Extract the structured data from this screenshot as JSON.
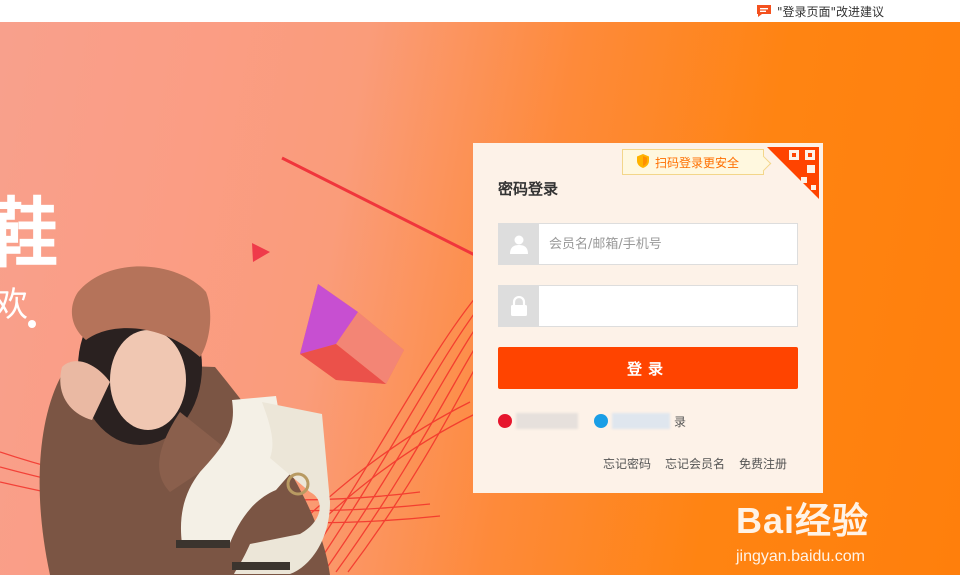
{
  "topbar": {
    "feedback_text": "\"登录页面\"改进建议",
    "feedback_icon": "chat-bubble-icon"
  },
  "banner": {
    "hero_text": "鞋",
    "hero_text2": "欢"
  },
  "login": {
    "title": "密码登录",
    "scan_tip": "扫码登录更安全",
    "username": {
      "placeholder": "会员名/邮箱/手机号",
      "value": "",
      "icon": "user-icon"
    },
    "password": {
      "placeholder": "",
      "value": "",
      "icon": "lock-icon"
    },
    "submit_label": "登录",
    "third_party": [
      {
        "icon": "weibo-icon",
        "label": ""
      },
      {
        "icon": "alipay-icon",
        "label": "录"
      }
    ],
    "links": [
      "忘记密码",
      "忘记会员名",
      "免费注册"
    ]
  },
  "watermark": {
    "brand": "Bai经验",
    "url": "jingyan.baidu.com"
  },
  "colors": {
    "accent": "#ff4400",
    "scan_tip_text": "#ff6f00",
    "annotation_arrow": "#f0363c"
  }
}
